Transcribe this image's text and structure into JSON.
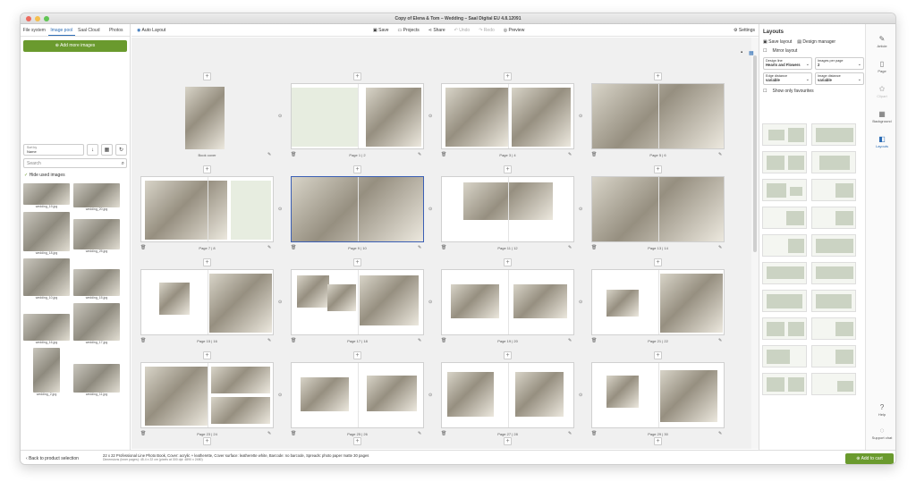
{
  "window": {
    "title": "Copy of Elena & Tom – Wedding – Saal Digital EU 4.8.12091"
  },
  "left_panel": {
    "tabs": [
      "File system",
      "Image pool",
      "Saal Cloud",
      "Photos"
    ],
    "add_button": "Add more images",
    "sort_label": "Sort by",
    "sort_value": "Name",
    "search_placeholder": "Search",
    "hide_used": "Hide used images",
    "images": [
      "wedding_19.jpg",
      "wedding_20.jpg",
      "wedding_18.jpg",
      "wedding_25.jpg",
      "wedding_10.jpg",
      "wedding_15.jpg",
      "wedding_16.jpg",
      "wedding_17.jpg",
      "wedding_2.jpg",
      "wedding_11.jpg"
    ]
  },
  "toolbar": {
    "auto_layout": "Auto Layout",
    "save": "Save",
    "projects": "Projects",
    "share": "Share",
    "undo": "Undo",
    "redo": "Redo",
    "preview": "Preview",
    "settings": "Settings"
  },
  "pages": [
    "Book cover",
    "Page 1 | 2",
    "Page 3 | 4",
    "Page 5 | 6",
    "Page 7 | 8",
    "Page 9 | 10",
    "Page 11 | 12",
    "Page 13 | 14",
    "Page 15 | 16",
    "Page 17 | 18",
    "Page 19 | 20",
    "Page 21 | 22",
    "Page 23 | 24",
    "Page 25 | 26",
    "Page 27 | 28",
    "Page 29 | 30"
  ],
  "right_panel": {
    "title": "Layouts",
    "save_layout": "Save layout",
    "design_manager": "Design manager",
    "mirror_layout": "Mirror layout",
    "design_line_label": "Design line",
    "design_line_value": "Hearts and Flowers",
    "images_per_page_label": "Images per page",
    "images_per_page_value": "2",
    "edge_distance_label": "Edge distance",
    "edge_distance_value": "variable",
    "image_distance_label": "Image distance",
    "image_distance_value": "variable",
    "show_favourites": "Show only favourites"
  },
  "iconbar": [
    "Article",
    "Page",
    "Clipart",
    "Background",
    "Layouts",
    "Help",
    "Support chat"
  ],
  "footer": {
    "back": "Back to product selection",
    "product": "22 x 22 Professional Line Photo Book, Cover: acrylic + leatherette, Cover surface: leatherette white, Barcode: no barcode, Spreads: photo paper matte 30 pages",
    "dimensions": "Dimensions (inner pages): 45.4 x 22 cm (pixels at 300 dpi: 4890 x 2480)",
    "cart": "Add to cart"
  }
}
